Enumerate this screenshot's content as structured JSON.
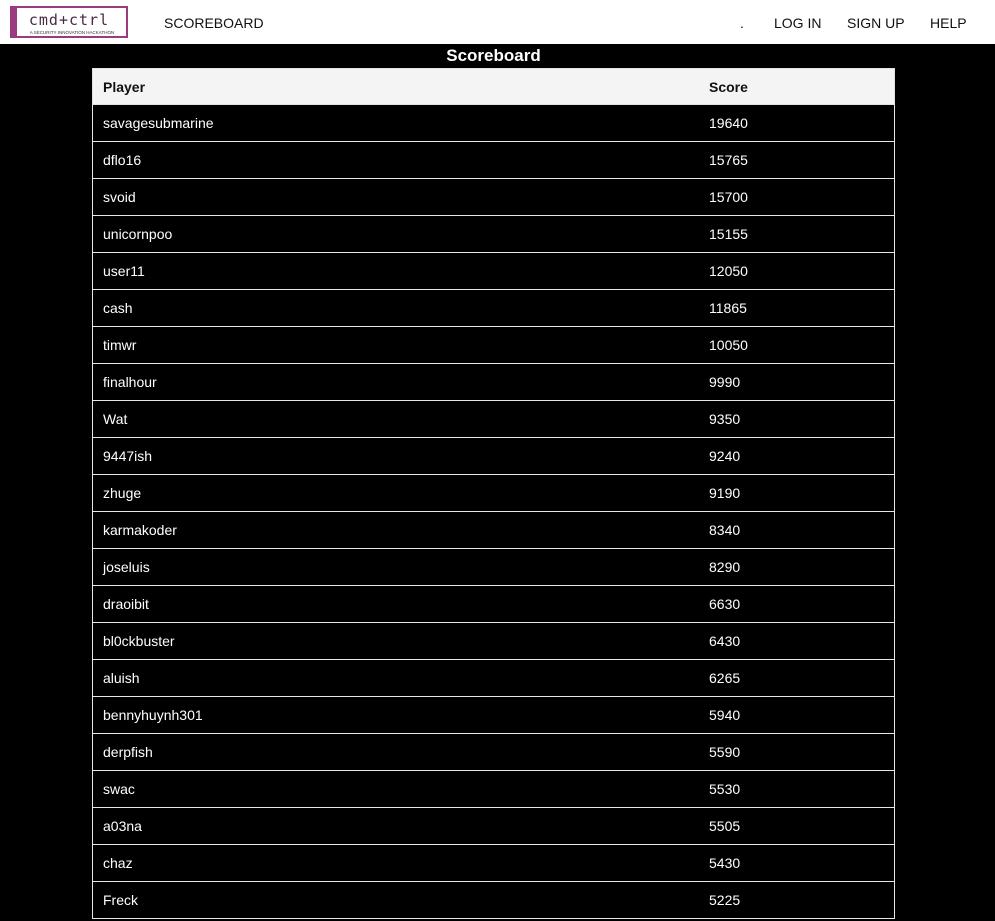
{
  "nav": {
    "logo": {
      "text": "cmd+ctrl",
      "tagline": "A SECURITY INNOVATION HACKATHON",
      "accent": "#9b3a7f"
    },
    "scoreboard": "SCOREBOARD",
    "dot": ".",
    "login": "LOG IN",
    "signup": "SIGN UP",
    "help": "HELP"
  },
  "page": {
    "title": "Scoreboard"
  },
  "table": {
    "headers": {
      "player": "Player",
      "score": "Score"
    },
    "rows": [
      {
        "player": "savagesubmarine",
        "score": "19640"
      },
      {
        "player": "dflo16",
        "score": "15765"
      },
      {
        "player": "svoid",
        "score": "15700"
      },
      {
        "player": "unicornpoo",
        "score": "15155"
      },
      {
        "player": "user11",
        "score": "12050"
      },
      {
        "player": "cash",
        "score": "11865"
      },
      {
        "player": "timwr",
        "score": "10050"
      },
      {
        "player": "finalhour",
        "score": "9990"
      },
      {
        "player": "Wat",
        "score": "9350"
      },
      {
        "player": "9447ish",
        "score": "9240"
      },
      {
        "player": "zhuge",
        "score": "9190"
      },
      {
        "player": "karmakoder",
        "score": "8340"
      },
      {
        "player": "joseluis",
        "score": "8290"
      },
      {
        "player": "draoibit",
        "score": "6630"
      },
      {
        "player": "bl0ckbuster",
        "score": "6430"
      },
      {
        "player": "aluish",
        "score": "6265"
      },
      {
        "player": "bennyhuynh301",
        "score": "5940"
      },
      {
        "player": "derpfish",
        "score": "5590"
      },
      {
        "player": "swac",
        "score": "5530"
      },
      {
        "player": "a03na",
        "score": "5505"
      },
      {
        "player": "chaz",
        "score": "5430"
      },
      {
        "player": "Freck",
        "score": "5225"
      }
    ]
  }
}
